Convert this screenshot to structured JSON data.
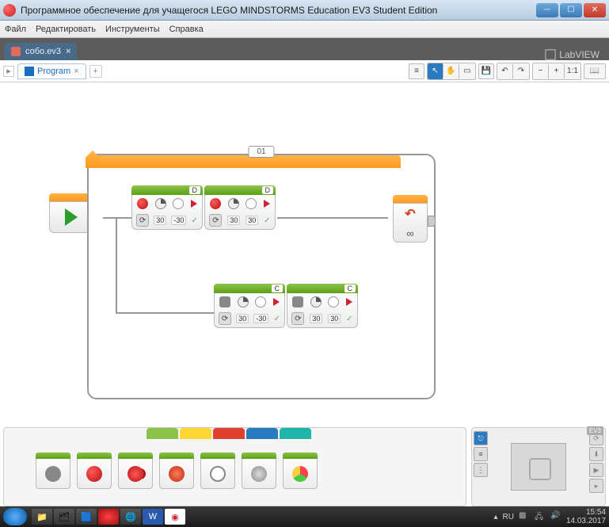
{
  "window": {
    "title": "Программное обеспечение для учащегося LEGO MINDSTORMS Education EV3 Student Edition"
  },
  "menu": {
    "file": "Файл",
    "edit": "Редактировать",
    "tools": "Инструменты",
    "help": "Справка"
  },
  "project": {
    "tab_name": "собо.ev3",
    "labview_label": "LabVIEW"
  },
  "program": {
    "tab_name": "Program",
    "add_label": "+",
    "toolbar": {
      "list": "≡",
      "pointer": "↖",
      "pan": "✋",
      "comment": "▭",
      "save": "💾",
      "undo": "↶",
      "redo": "↷",
      "zoom_out": "−",
      "zoom_in": "+",
      "zoom_fit": "1:1",
      "help": "📖"
    }
  },
  "canvas": {
    "loop_label": "01",
    "loop_infinity": "∞",
    "blocks": {
      "b1": {
        "port": "D",
        "v1": "30",
        "v2": "-30"
      },
      "b2": {
        "port": "D",
        "v1": "30",
        "v2": "30"
      },
      "b3": {
        "port": "C",
        "v1": "30",
        "v2": "-30"
      },
      "b4": {
        "port": "C",
        "v1": "30",
        "v2": "30"
      }
    }
  },
  "palette": {
    "ev3_label": "EV3"
  },
  "taskbar": {
    "lang": "RU",
    "time": "15:54",
    "date": "14.03.2017"
  }
}
